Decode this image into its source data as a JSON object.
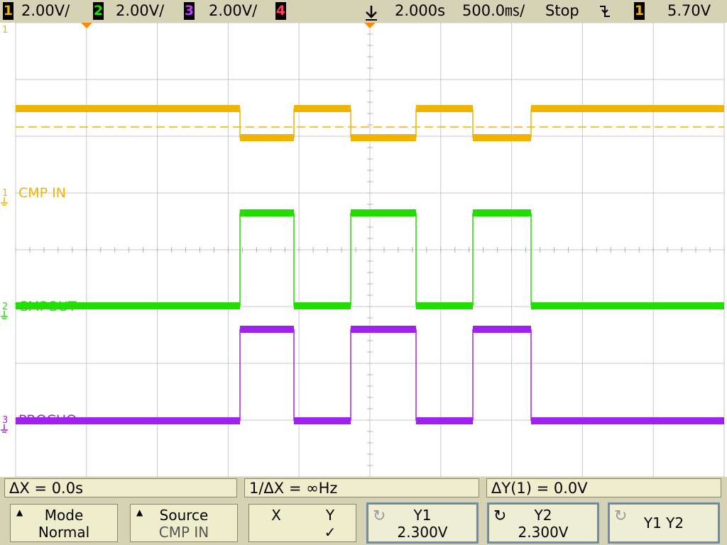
{
  "topbar": {
    "ch1": {
      "num": "1",
      "scale": "2.00V/",
      "color": "#f0b400"
    },
    "ch2": {
      "num": "2",
      "scale": "2.00V/",
      "color": "#22dd00"
    },
    "ch3": {
      "num": "3",
      "scale": "2.00V/",
      "color": "#a020f0"
    },
    "ch4": {
      "num": "4",
      "color": "#ff4060"
    },
    "trigger_position_icon": "down-arrow-icon",
    "time_delay": "2.000s",
    "time_scale": "500.0㎳/",
    "run_state": "Stop",
    "trigger_edge_icon": "falling-edge-icon",
    "trigger_source": "1",
    "trigger_level": "5.70V"
  },
  "channels": [
    {
      "marker": "1",
      "label": "CMP IN",
      "color": "#f0b400"
    },
    {
      "marker": "2",
      "label": "CMPOUT",
      "color": "#22dd00"
    },
    {
      "marker": "3",
      "label": "PROCHO",
      "color": "#a020f0"
    }
  ],
  "measurements": {
    "delta_x": "ΔX = 0.0s",
    "inv_delta_x": "1/ΔX = ∞Hz",
    "delta_y": "ΔY(1) = 0.0V"
  },
  "softkeys": {
    "mode": {
      "label": "Mode",
      "value": "Normal"
    },
    "source": {
      "label": "Source",
      "value": "CMP IN"
    },
    "xy": {
      "x": "X",
      "y": "Y",
      "check": "✓"
    },
    "y1": {
      "label": "Y1",
      "value": "2.300V"
    },
    "y2": {
      "label": "Y2",
      "value": "2.300V"
    },
    "y1y2": {
      "label": "Y1 Y2"
    }
  }
}
